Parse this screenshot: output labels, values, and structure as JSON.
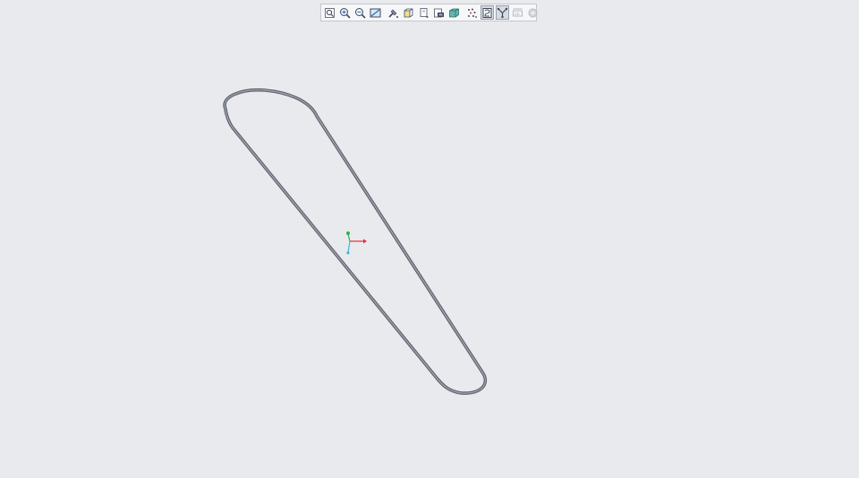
{
  "toolbar": {
    "buttons": [
      {
        "icon": "zoom-to-fit-icon"
      },
      {
        "icon": "zoom-in-icon"
      },
      {
        "icon": "zoom-out-icon"
      },
      {
        "icon": "zoom-area-icon"
      },
      {
        "icon": "pan-icon"
      },
      {
        "icon": "view-orientation-icon"
      },
      {
        "icon": "display-style-icon"
      },
      {
        "icon": "section-view-icon"
      },
      {
        "icon": "appearance-icon"
      },
      {
        "icon": "view-settings-icon"
      },
      {
        "icon": "datum-display-icon"
      },
      {
        "icon": "sketch-view-icon"
      },
      {
        "icon": "annotation-display-icon"
      },
      {
        "icon": "spin-center-icon"
      }
    ]
  },
  "colors": {
    "background": "#e9eaee",
    "sketch_outline": "#6b717c",
    "axis_x": "#e0303a",
    "axis_y": "#2bb34a",
    "axis_z": "#3fb6d8"
  }
}
